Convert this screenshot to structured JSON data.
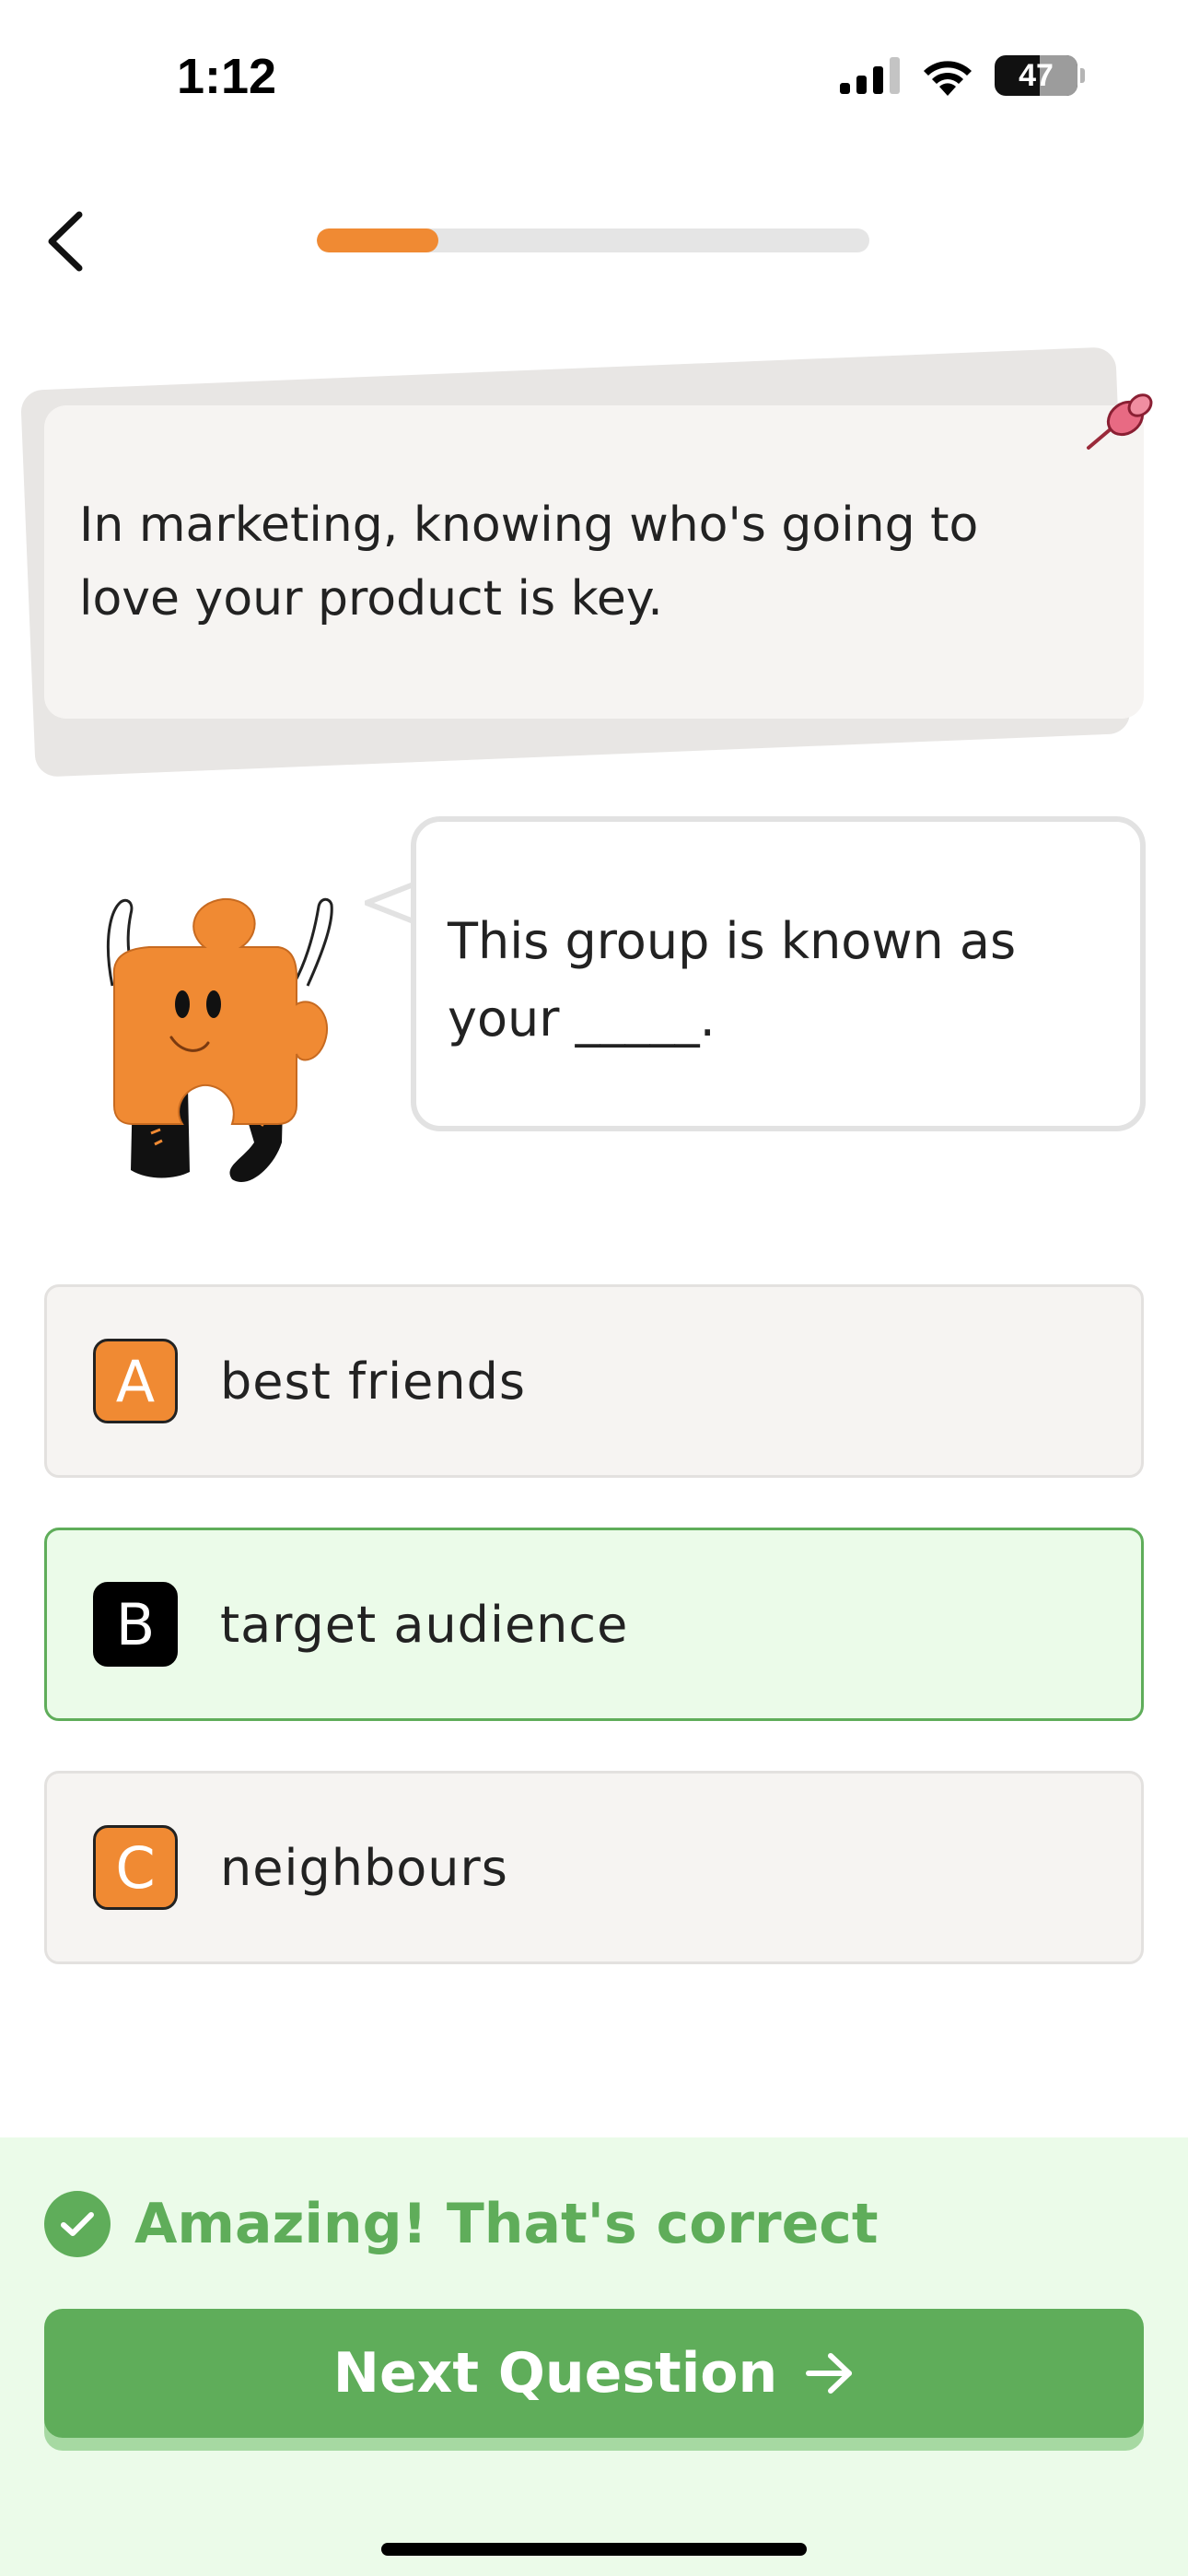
{
  "status_bar": {
    "time": "1:12",
    "battery_level": "47",
    "icons": [
      "signal-icon",
      "wifi-icon",
      "battery-icon"
    ]
  },
  "header": {
    "back_icon": "chevron-left-icon",
    "progress_fraction": 0.22
  },
  "context_card": {
    "text": "In marketing, knowing who's going to love your product is key.",
    "icon": "pushpin-icon"
  },
  "question": {
    "mascot": "puzzle-piece-mascot",
    "prompt": "This group is known as your _____."
  },
  "options": [
    {
      "letter": "A",
      "label": "best friends",
      "state": "default"
    },
    {
      "letter": "B",
      "label": "target audience",
      "state": "correct"
    },
    {
      "letter": "C",
      "label": "neighbours",
      "state": "default"
    }
  ],
  "feedback": {
    "message": "Amazing! That's correct",
    "next_button_label": "Next Question",
    "next_icon": "arrow-right-icon"
  },
  "colors": {
    "accent_orange": "#f08a33",
    "success_green": "#5fad5a",
    "success_bg": "#ebfbe9",
    "card_bg": "#f6f4f2"
  }
}
